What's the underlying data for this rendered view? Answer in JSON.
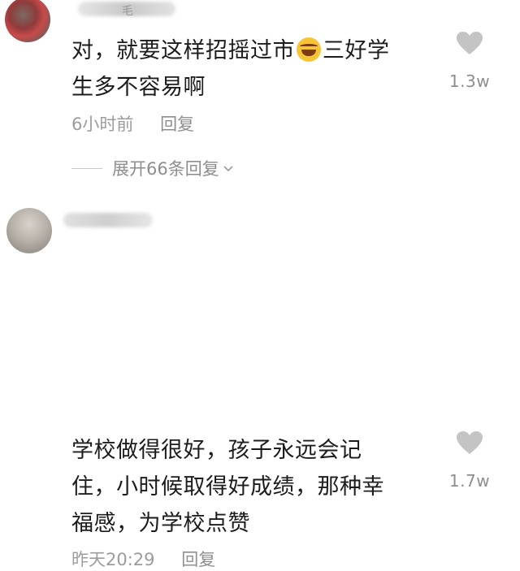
{
  "comments": [
    {
      "username_visible": "毛",
      "line1": "对，就要这样招摇过市",
      "emoji": "rolling-on-floor-laughing",
      "line1_after_emoji": "三好学",
      "line2": "生多不容易啊",
      "time": "6小时前",
      "reply_label": "回复",
      "likes": "1.3w",
      "expand_label": "展开66条回复"
    },
    {
      "line1": "学校做得很好，孩子永远会记",
      "line2": "住，小时候取得好成绩，那种幸",
      "line3": "福感，为学校点赞",
      "time": "昨天20:29",
      "reply_label": "回复",
      "likes": "1.7w"
    }
  ],
  "icons": {
    "heart": "heart-icon",
    "chevron": "chevron-down-icon"
  },
  "colors": {
    "text": "#1c1c1c",
    "meta": "#9c9c9c",
    "heart": "#c4c4c4",
    "background": "#ffffff"
  }
}
